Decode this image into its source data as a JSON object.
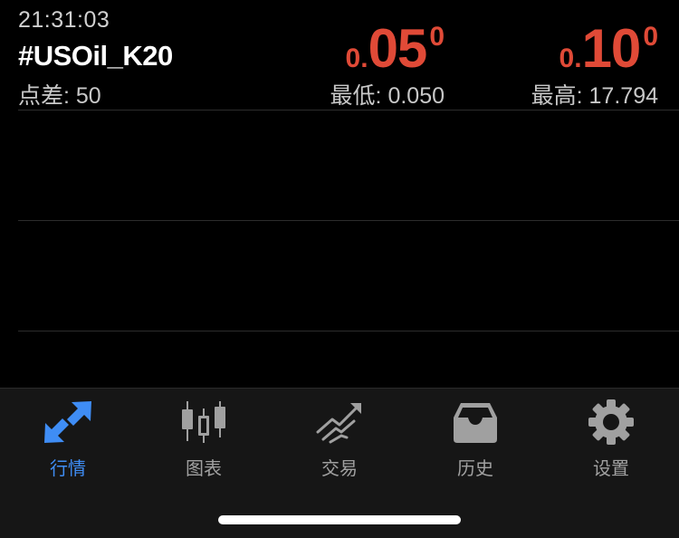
{
  "status": {
    "time": "21:31:03"
  },
  "quote": {
    "symbol": "#USOil_K20",
    "spread_label": "点差: 50",
    "bid": {
      "small": "0.",
      "big": "05",
      "sup": "0"
    },
    "ask": {
      "small": "0.",
      "big": "10",
      "sup": "0"
    },
    "low_label": "最低: 0.050",
    "high_label": "最高: 17.794"
  },
  "colors": {
    "price": "#e04a37",
    "active_tab": "#3f8df5",
    "inactive_tab": "#a0a0a0"
  },
  "tabs": [
    {
      "label": "行情",
      "icon": "quotes-arrows-icon",
      "active": true
    },
    {
      "label": "图表",
      "icon": "candlestick-chart-icon",
      "active": false
    },
    {
      "label": "交易",
      "icon": "trade-trend-icon",
      "active": false
    },
    {
      "label": "历史",
      "icon": "history-inbox-icon",
      "active": false
    },
    {
      "label": "设置",
      "icon": "gear-icon",
      "active": false
    }
  ]
}
